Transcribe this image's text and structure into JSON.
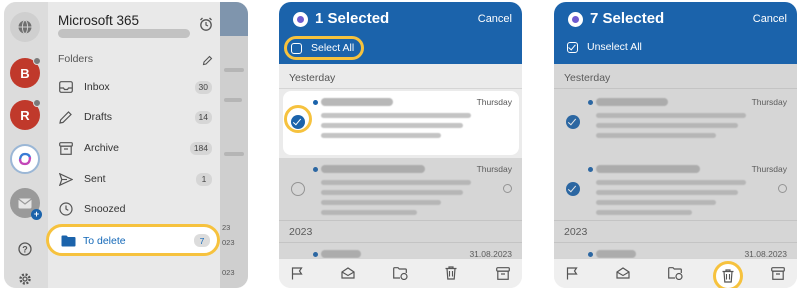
{
  "panel1": {
    "account_title": "Microsoft 365",
    "folders_label": "Folders",
    "rail": [
      {
        "icon": "globe-icon"
      },
      {
        "letter": "B",
        "color": "#c0392b"
      },
      {
        "letter": "R",
        "color": "#c0392b"
      },
      {
        "icon": "copilot-icon"
      },
      {
        "icon": "mail-add-icon"
      },
      {
        "icon": "help-icon"
      },
      {
        "icon": "settings-icon"
      }
    ],
    "folders": [
      {
        "label": "Inbox",
        "count": "30",
        "icon": "inbox-icon"
      },
      {
        "label": "Drafts",
        "count": "14",
        "icon": "drafts-icon"
      },
      {
        "label": "Archive",
        "count": "184",
        "icon": "archive-icon"
      },
      {
        "label": "Sent",
        "count": "1",
        "icon": "sent-icon"
      },
      {
        "label": "Snoozed",
        "count": "",
        "icon": "clock-icon"
      }
    ],
    "highlighted_folder": {
      "label": "To delete",
      "count": "7",
      "icon": "folder-icon"
    },
    "behind_list": {
      "times": [
        "23",
        "023",
        "023"
      ]
    }
  },
  "panel2": {
    "title": "1 Selected",
    "cancel": "Cancel",
    "select_all": "Select All",
    "groups": [
      "Yesterday",
      "2023"
    ],
    "emails": [
      {
        "day": "Thursday",
        "selected": true
      },
      {
        "day": "Thursday",
        "selected": false
      },
      {
        "day": "31.08.2023",
        "selected": false
      }
    ]
  },
  "panel3": {
    "title": "7 Selected",
    "cancel": "Cancel",
    "unselect_all": "Unselect All",
    "groups": [
      "Yesterday",
      "2023"
    ],
    "emails": [
      {
        "day": "Thursday",
        "selected": true
      },
      {
        "day": "Thursday",
        "selected": true
      },
      {
        "day": "31.08.2023",
        "selected": true
      }
    ]
  },
  "toolbar": [
    "flag-icon",
    "open-mail-icon",
    "move-folder-icon",
    "delete-icon",
    "archive-icon"
  ],
  "colors": {
    "accent": "#1b63ab",
    "highlight": "#f6c23e",
    "alert": "#c0392b"
  }
}
